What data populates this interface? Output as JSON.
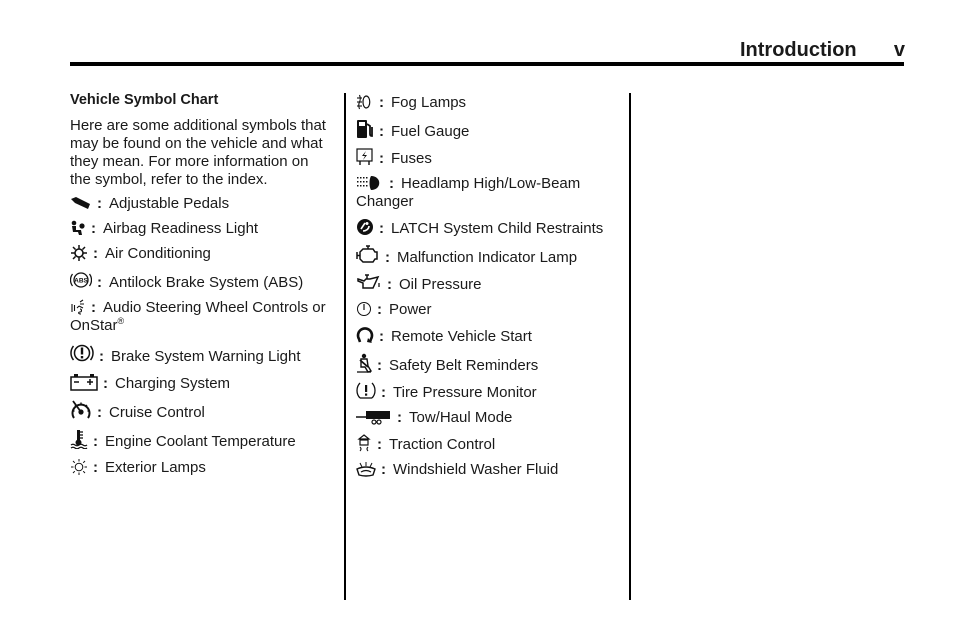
{
  "header": {
    "title": "Introduction",
    "page_number": "v"
  },
  "section": {
    "title": "Vehicle Symbol Chart",
    "intro": "Here are some additional symbols that may be found on the vehicle and what they mean. For more information on the symbol, refer to the index."
  },
  "separator": ":",
  "column1": [
    {
      "icon": "adjustable-pedals-icon",
      "label": "Adjustable Pedals"
    },
    {
      "icon": "airbag-readiness-icon",
      "label": "Airbag Readiness Light"
    },
    {
      "icon": "air-conditioning-icon",
      "label": "Air Conditioning"
    },
    {
      "icon": "abs-icon",
      "label": "Antilock Brake System (ABS)"
    },
    {
      "icon": "audio-steering-controls-icon",
      "label": "Audio Steering Wheel Controls or OnStar",
      "superscript": "®"
    },
    {
      "icon": "brake-warning-icon",
      "label": "Brake System Warning Light"
    },
    {
      "icon": "battery-icon",
      "label": "Charging System"
    },
    {
      "icon": "cruise-control-icon",
      "label": "Cruise Control"
    },
    {
      "icon": "coolant-temperature-icon",
      "label": "Engine Coolant Temperature"
    },
    {
      "icon": "exterior-lamps-icon",
      "label": "Exterior Lamps"
    }
  ],
  "column2": [
    {
      "icon": "fog-lamps-icon",
      "label": "Fog Lamps"
    },
    {
      "icon": "fuel-gauge-icon",
      "label": "Fuel Gauge"
    },
    {
      "icon": "fuses-icon",
      "label": "Fuses"
    },
    {
      "icon": "headlamp-beam-icon",
      "label": "Headlamp High/Low-Beam Changer"
    },
    {
      "icon": "latch-child-restraint-icon",
      "label": "LATCH System Child Restraints"
    },
    {
      "icon": "check-engine-icon",
      "label": "Malfunction Indicator Lamp"
    },
    {
      "icon": "oil-pressure-icon",
      "label": "Oil Pressure"
    },
    {
      "icon": "power-icon",
      "label": "Power"
    },
    {
      "icon": "remote-start-icon",
      "label": "Remote Vehicle Start"
    },
    {
      "icon": "seatbelt-icon",
      "label": "Safety Belt Reminders"
    },
    {
      "icon": "tire-pressure-icon",
      "label": "Tire Pressure Monitor"
    },
    {
      "icon": "tow-haul-icon",
      "label": "Tow/Haul Mode"
    },
    {
      "icon": "traction-control-icon",
      "label": "Traction Control"
    },
    {
      "icon": "washer-fluid-icon",
      "label": "Windshield Washer Fluid"
    }
  ]
}
